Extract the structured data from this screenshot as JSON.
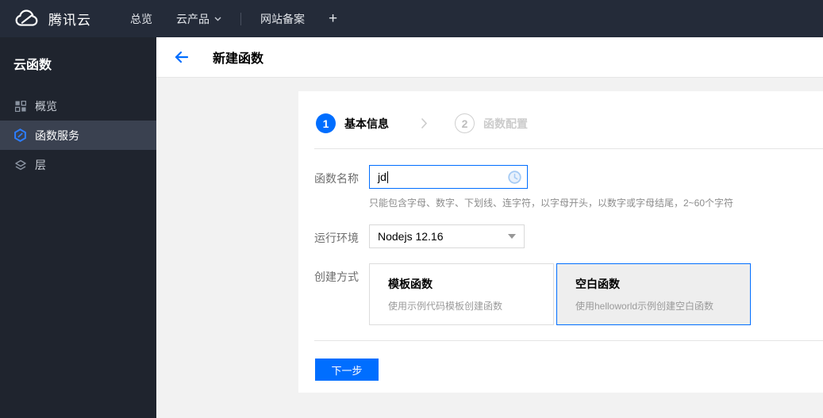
{
  "topbar": {
    "brand": "腾讯云",
    "nav": [
      {
        "label": "总览"
      },
      {
        "label": "云产品"
      },
      {
        "label": "网站备案"
      }
    ],
    "plus_label": "+"
  },
  "sidebar": {
    "title": "云函数",
    "items": [
      {
        "label": "概览",
        "icon": "grid-icon",
        "active": false
      },
      {
        "label": "函数服务",
        "icon": "scf-hexagon-icon",
        "active": true
      },
      {
        "label": "层",
        "icon": "layers-icon",
        "active": false
      }
    ]
  },
  "header": {
    "title": "新建函数"
  },
  "wizard": {
    "steps": [
      {
        "num": "1",
        "label": "基本信息",
        "active": true
      },
      {
        "num": "2",
        "label": "函数配置",
        "active": false
      }
    ]
  },
  "form": {
    "name": {
      "label": "函数名称",
      "value": "jd",
      "suffix_icon": "clock-pending-icon",
      "hint": "只能包含字母、数字、下划线、连字符，以字母开头，以数字或字母结尾，2~60个字符"
    },
    "runtime": {
      "label": "运行环境",
      "value": "Nodejs 12.16"
    },
    "method": {
      "label": "创建方式",
      "options": [
        {
          "title": "模板函数",
          "desc": "使用示例代码模板创建函数",
          "selected": false
        },
        {
          "title": "空白函数",
          "desc": "使用helloworld示例创建空白函数",
          "selected": true
        }
      ]
    }
  },
  "footer": {
    "next_label": "下一步"
  },
  "colors": {
    "accent": "#006eff",
    "topbar_bg": "#242b39",
    "sidebar_bg": "#1f242e",
    "sidebar_active_bg": "#3a4150",
    "selected_card_bg": "#eeeeee"
  }
}
